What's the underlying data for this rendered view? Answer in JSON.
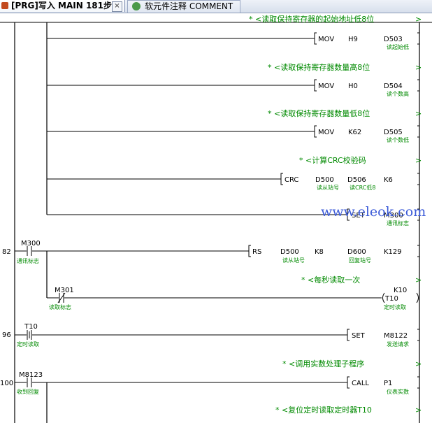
{
  "tabs": [
    {
      "icon": "program-icon",
      "label": "[PRG]写入 MAIN 181步",
      "close": "×"
    },
    {
      "icon": "comment-icon",
      "label": "软元件注释 COMMENT"
    }
  ],
  "rung_numbers": [
    "82",
    "96",
    "100"
  ],
  "comments": {
    "c1": "* <读取保持寄存器的起始地址低8位",
    "c2": "* <读取保持寄存器数量高8位",
    "c3": "* <读取保持寄存器数量低8位",
    "c4": "* <计算CRC校验码",
    "c5": "* <每秒读取一次",
    "c6": "* <调用实数处理子程序",
    "c7": "* <复位定时读取定时器T10"
  },
  "arrow": ">",
  "instructions": [
    {
      "mnemonic": "MOV",
      "op1": "H9",
      "op2": "D503",
      "op2_desc": "读起始低"
    },
    {
      "mnemonic": "MOV",
      "op1": "H0",
      "op2": "D504",
      "op2_desc": "读个数高"
    },
    {
      "mnemonic": "MOV",
      "op1": "K62",
      "op2": "D505",
      "op2_desc": "读个数低"
    },
    {
      "mnemonic": "CRC",
      "op1": "D500",
      "op1_desc": "读从站号",
      "op2": "D506",
      "op2_desc": "读CRC低8",
      "op3": "K6"
    },
    {
      "mnemonic": "SET",
      "op1": "M300",
      "op1_desc": "通讯标志"
    },
    {
      "mnemonic": "RS",
      "op1": "D500",
      "op1_desc": "读从站号",
      "op2": "K8",
      "op3": "D600",
      "op3_desc": "回复站号",
      "op4": "K129"
    },
    {
      "mnemonic": "SET",
      "op1": "M8122",
      "op1_desc": "发送请求"
    },
    {
      "mnemonic": "CALL",
      "op1": "P1",
      "op1_desc": "仪表实数"
    }
  ],
  "contacts": [
    {
      "device": "M300",
      "desc": "通讯标志"
    },
    {
      "device": "M301",
      "desc": "读取标志"
    },
    {
      "device": "T10",
      "desc": "定时读取"
    },
    {
      "device": "M8123",
      "desc": "收到回复"
    }
  ],
  "timer": {
    "device": "T10",
    "setting": "K10",
    "desc": "定时读取"
  },
  "watermark": "www.eleok.com",
  "colors": {
    "comment": "#008a00",
    "rail": "#000000",
    "tab_active": "#ffffff",
    "watermark": "#3c5bd8"
  }
}
